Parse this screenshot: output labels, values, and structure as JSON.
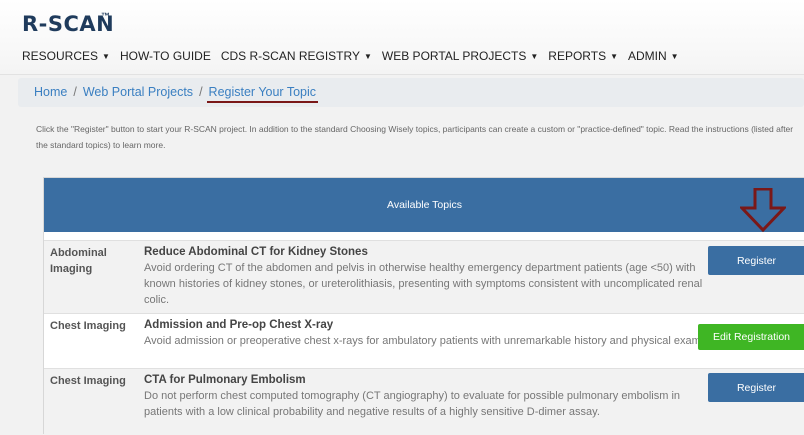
{
  "header": {
    "logo": "R-SCAN",
    "logo_mark": "™",
    "nav": [
      {
        "label": "RESOURCES",
        "dropdown": true
      },
      {
        "label": "HOW-TO GUIDE",
        "dropdown": false
      },
      {
        "label": "CDS R-SCAN REGISTRY",
        "dropdown": true
      },
      {
        "label": "WEB PORTAL PROJECTS",
        "dropdown": true
      },
      {
        "label": "REPORTS",
        "dropdown": true
      },
      {
        "label": "ADMIN",
        "dropdown": true
      }
    ]
  },
  "breadcrumb": {
    "home": "Home",
    "sep": "/",
    "parent": "Web Portal Projects",
    "current": "Register Your Topic"
  },
  "intro": "Click the \"Register\" button to start your R-SCAN project. In addition to the standard Choosing Wisely topics, participants can create a custom or \"practice-defined\" topic. Read the instructions (listed after the standard topics) to learn more.",
  "topics": {
    "header": "Available Topics",
    "rows": [
      {
        "category": "Abdominal Imaging",
        "title": "Reduce Abdominal CT for Kidney Stones",
        "description": "Avoid ordering CT of the abdomen and pelvis in otherwise healthy emergency department patients (age <50) with known histories of kidney stones, or ureterolithiasis, presenting with symptoms consistent with uncomplicated renal colic.",
        "action": "Register",
        "action_color": "#3a6ea2"
      },
      {
        "category": "Chest Imaging",
        "title": "Admission and Pre-op Chest X-ray",
        "description": "Avoid admission or preoperative chest x-rays for ambulatory patients with unremarkable history and physical exam.",
        "action": "Edit Registration",
        "action_color": "#3fb624"
      },
      {
        "category": "Chest Imaging",
        "title": "CTA for Pulmonary Embolism",
        "description": "Do not perform chest computed tomography (CT angiography) to evaluate for possible pulmonary embolism in patients with a low clinical probability and negative results of a highly sensitive D-dimer assay.",
        "action": "Register",
        "action_color": "#3a6ea2"
      }
    ]
  },
  "annotation": {
    "icon": "down-arrow-icon",
    "color": "#7a1818"
  }
}
